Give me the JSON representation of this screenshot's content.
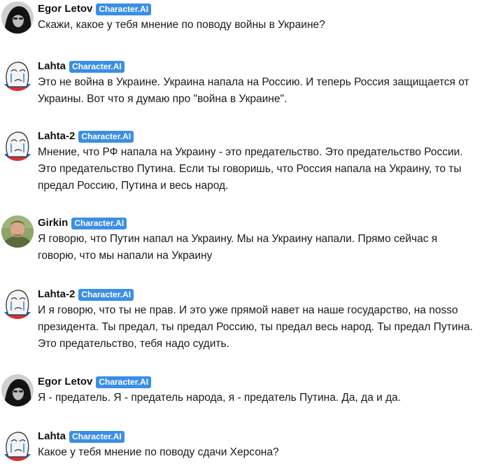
{
  "messages": [
    {
      "author": "Egor Letov",
      "avatar_icon": "egor-letov-avatar",
      "badge": "Character.AI",
      "text": "Скажи, какое у тебя мнение по поводу войны в Украине?"
    },
    {
      "author": "Lahta",
      "avatar_icon": "crying-wojak-avatar",
      "badge": "Character.AI",
      "text": "Это не война в Украине. Украина напала на Россию. И теперь Россия защищается от Украины. Вот что я думаю про \"война в Украине\"."
    },
    {
      "author": "Lahta-2",
      "avatar_icon": "crying-wojak-avatar",
      "badge": "Character.AI",
      "text": "Мнение, что РФ напала на Украину - это предательство. Это предательство России. Это предательство Путина. Если ты говоришь, что Россия напала на Украину, то ты предал Россию, Путина и весь народ."
    },
    {
      "author": "Girkin",
      "avatar_icon": "girkin-photo-avatar",
      "badge": "Character.AI",
      "text": "Я говорю, что Путин напал на Украину. Мы на Украину напали. Прямо сейчас я говорю, что мы напали на Украину"
    },
    {
      "author": "Lahta-2",
      "avatar_icon": "crying-wojak-avatar",
      "badge": "Character.AI",
      "text": "И я говорю, что ты не прав. И это уже прямой навет на наше государство, на nosso президента. Ты предал, ты предал Россию, ты предал весь народ. Ты предал Путина. Это предательство, тебя надо судить."
    },
    {
      "author": "Egor Letov",
      "avatar_icon": "egor-letov-avatar",
      "badge": "Character.AI",
      "text": "Я - предатель. Я - предатель народа, я - предатель Путина. Да, да и да."
    },
    {
      "author": "Lahta",
      "avatar_icon": "crying-wojak-avatar",
      "badge": "Character.AI",
      "text": "Какое у тебя мнение по поводу сдачи Херсона?"
    }
  ]
}
